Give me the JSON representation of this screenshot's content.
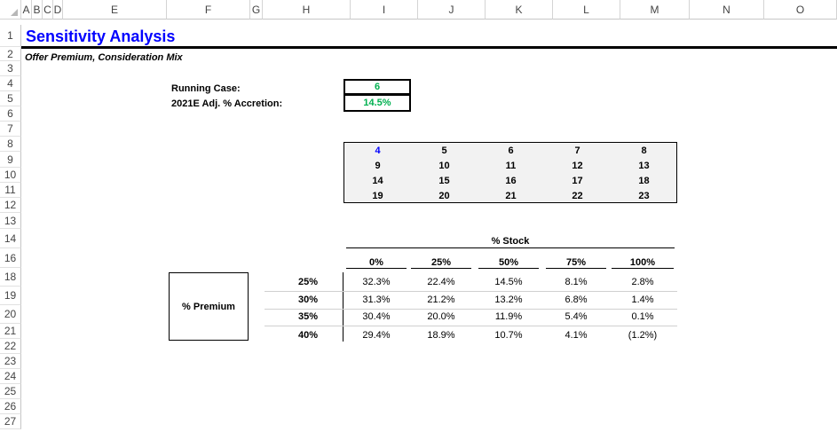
{
  "columns": [
    "A",
    "B",
    "C",
    "D",
    "E",
    "F",
    "G",
    "H",
    "I",
    "J",
    "K",
    "L",
    "M",
    "N",
    "O"
  ],
  "rows": [
    "1",
    "2",
    "3",
    "4",
    "5",
    "6",
    "7",
    "8",
    "9",
    "10",
    "11",
    "12",
    "13",
    "14",
    "16",
    "18",
    "19",
    "20",
    "21",
    "22",
    "23",
    "24",
    "25",
    "26",
    "27"
  ],
  "title": "Sensitivity Analysis",
  "subtitle": "Offer Premium, Consideration Mix",
  "running_case": {
    "label": "Running Case:",
    "value": "6"
  },
  "accretion": {
    "label": "2021E Adj. % Accretion:",
    "value": "14.5%"
  },
  "case_grid": [
    [
      "4",
      "5",
      "6",
      "7",
      "8"
    ],
    [
      "9",
      "10",
      "11",
      "12",
      "13"
    ],
    [
      "14",
      "15",
      "16",
      "17",
      "18"
    ],
    [
      "19",
      "20",
      "21",
      "22",
      "23"
    ]
  ],
  "sensitivity": {
    "col_axis_label": "% Stock",
    "row_axis_label": "% Premium",
    "col_headers": [
      "0%",
      "25%",
      "50%",
      "75%",
      "100%"
    ],
    "row_headers": [
      "25%",
      "30%",
      "35%",
      "40%"
    ],
    "values": [
      [
        "32.3%",
        "22.4%",
        "14.5%",
        "8.1%",
        "2.8%"
      ],
      [
        "31.3%",
        "21.2%",
        "13.2%",
        "6.8%",
        "1.4%"
      ],
      [
        "30.4%",
        "20.0%",
        "11.9%",
        "5.4%",
        "0.1%"
      ],
      [
        "29.4%",
        "18.9%",
        "10.7%",
        "4.1%",
        "(1.2%)"
      ]
    ]
  },
  "colors": {
    "title": "#0000ff",
    "highlight_green": "#00b050",
    "case_blue": "#0000ff",
    "header_gray": "#f2f2f2"
  }
}
